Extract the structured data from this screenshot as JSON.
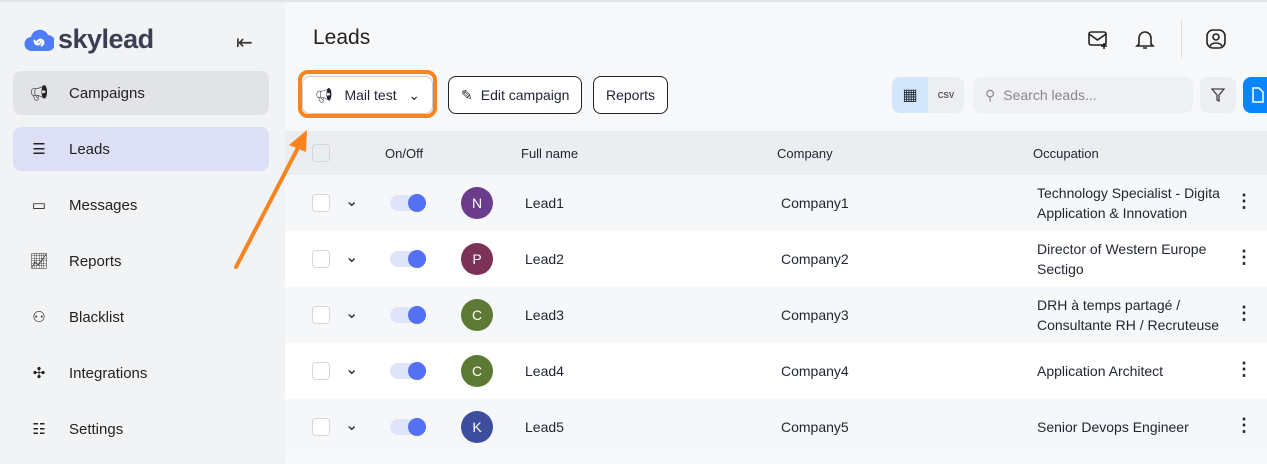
{
  "brand": {
    "name": "skylead",
    "accent": "#4f7cf7"
  },
  "sidebar": {
    "items": [
      {
        "label": "Campaigns",
        "icon": "megaphone-icon"
      },
      {
        "label": "Leads",
        "icon": "leads-search-icon"
      },
      {
        "label": "Messages",
        "icon": "message-icon"
      },
      {
        "label": "Reports",
        "icon": "chart-icon"
      },
      {
        "label": "Blacklist",
        "icon": "user-block-icon"
      },
      {
        "label": "Integrations",
        "icon": "puzzle-icon"
      },
      {
        "label": "Settings",
        "icon": "sliders-icon"
      }
    ]
  },
  "header": {
    "title": "Leads"
  },
  "toolbar": {
    "campaign_select": "Mail test",
    "edit_campaign": "Edit campaign",
    "reports": "Reports",
    "search_placeholder": "Search leads..."
  },
  "table": {
    "headers": [
      "On/Off",
      "Full name",
      "Company",
      "Occupation"
    ],
    "rows": [
      {
        "initial": "N",
        "color": "#6b3b8c",
        "name": "Lead1",
        "company": "Company1",
        "occupation": [
          "Technology Specialist - Digital",
          "Application & Innovation"
        ],
        "on": true
      },
      {
        "initial": "P",
        "color": "#7c3159",
        "name": "Lead2",
        "company": "Company2",
        "occupation": [
          "Director of Western Europe",
          "Sectigo"
        ],
        "on": true
      },
      {
        "initial": "C",
        "color": "#5d7a35",
        "name": "Lead3",
        "company": "Company3",
        "occupation": [
          "DRH à temps partagé /",
          "Consultante RH / Recruteuse"
        ],
        "on": true
      },
      {
        "initial": "C",
        "color": "#5d7a35",
        "name": "Lead4",
        "company": "Company4",
        "occupation": [
          "Application Architect"
        ],
        "on": true
      },
      {
        "initial": "K",
        "color": "#3e4e9e",
        "name": "Lead5",
        "company": "Company5",
        "occupation": [
          "Senior Devops Engineer"
        ],
        "on": true
      }
    ]
  },
  "annotation": {
    "color": "#f7841f"
  }
}
